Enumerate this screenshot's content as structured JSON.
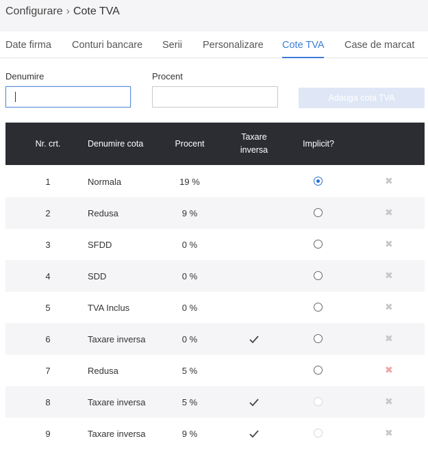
{
  "breadcrumb": {
    "parent": "Configurare",
    "separator": "›",
    "current": "Cote TVA"
  },
  "tabs": [
    {
      "label": "Date firma",
      "active": false
    },
    {
      "label": "Conturi bancare",
      "active": false
    },
    {
      "label": "Serii",
      "active": false
    },
    {
      "label": "Personalizare",
      "active": false
    },
    {
      "label": "Cote TVA",
      "active": true
    },
    {
      "label": "Case de marcat",
      "active": false
    }
  ],
  "form": {
    "denumire_label": "Denumire",
    "denumire_value": "",
    "procent_label": "Procent",
    "procent_value": "",
    "add_label": "Adauga cota TVA"
  },
  "table": {
    "headers": {
      "nr": "Nr. crt.",
      "denumire": "Denumire cota",
      "procent": "Procent",
      "taxare_line1": "Taxare",
      "taxare_line2": "inversa",
      "implicit": "Implicit?"
    },
    "rows": [
      {
        "nr": "1",
        "denumire": "Normala",
        "procent": "19 %",
        "taxare_inversa": false,
        "implicit": "selected",
        "delete_color": "#c7c7c7"
      },
      {
        "nr": "2",
        "denumire": "Redusa",
        "procent": "9 %",
        "taxare_inversa": false,
        "implicit": "unselected",
        "delete_color": "#c7c7c7"
      },
      {
        "nr": "3",
        "denumire": "SFDD",
        "procent": "0 %",
        "taxare_inversa": false,
        "implicit": "unselected",
        "delete_color": "#c7c7c7"
      },
      {
        "nr": "4",
        "denumire": "SDD",
        "procent": "0 %",
        "taxare_inversa": false,
        "implicit": "unselected",
        "delete_color": "#c7c7c7"
      },
      {
        "nr": "5",
        "denumire": "TVA Inclus",
        "procent": "0 %",
        "taxare_inversa": false,
        "implicit": "unselected",
        "delete_color": "#c7c7c7"
      },
      {
        "nr": "6",
        "denumire": "Taxare inversa",
        "procent": "0 %",
        "taxare_inversa": true,
        "implicit": "unselected",
        "delete_color": "#c7c7c7"
      },
      {
        "nr": "7",
        "denumire": "Redusa",
        "procent": "5 %",
        "taxare_inversa": false,
        "implicit": "unselected",
        "delete_color": "#f0a3a3"
      },
      {
        "nr": "8",
        "denumire": "Taxare inversa",
        "procent": "5 %",
        "taxare_inversa": true,
        "implicit": "disabled",
        "delete_color": "#c7c7c7"
      },
      {
        "nr": "9",
        "denumire": "Taxare inversa",
        "procent": "9 %",
        "taxare_inversa": true,
        "implicit": "disabled",
        "delete_color": "#c7c7c7"
      }
    ]
  },
  "colors": {
    "accent": "#3b7dd8",
    "header_bg": "#2b2d33",
    "alt_row": "#f5f5f7",
    "button_disabled": "#dfe7f6"
  },
  "icons": {
    "check": "check-icon",
    "delete": "close-icon",
    "separator": "chevron-right-icon"
  }
}
